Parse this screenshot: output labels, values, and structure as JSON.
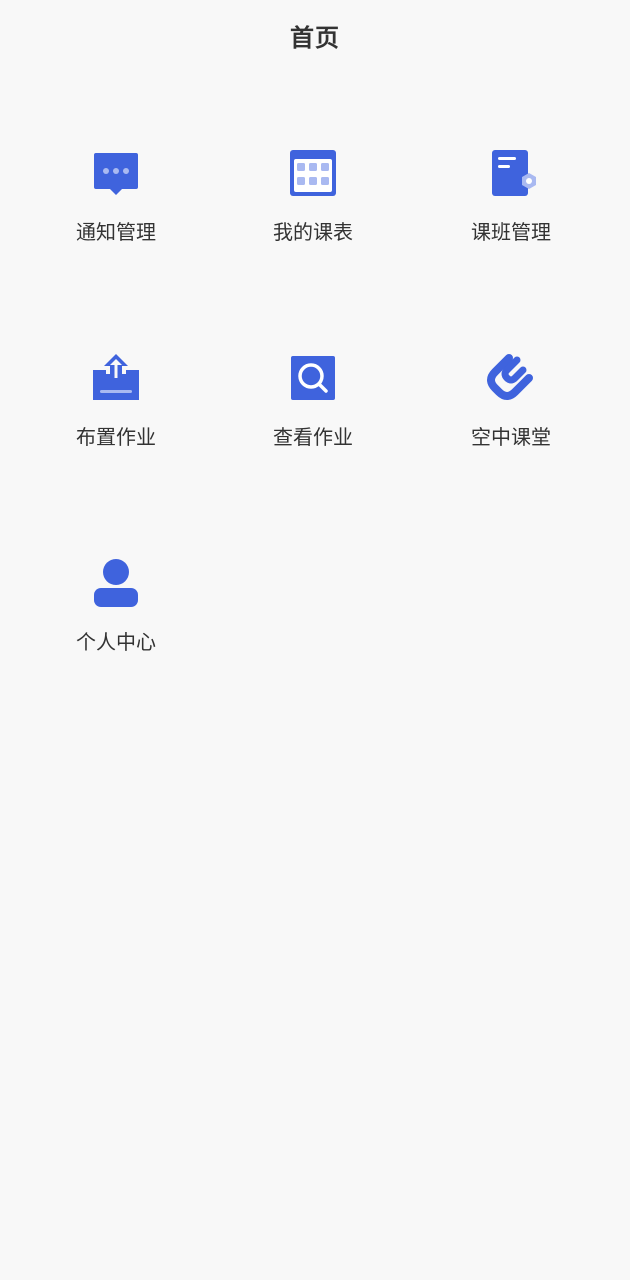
{
  "header": {
    "title": "首页"
  },
  "theme": {
    "accent": "#3f63dd",
    "accent_light": "#a9b9f1"
  },
  "menu": [
    {
      "label": "通知管理",
      "icon": "message-icon"
    },
    {
      "label": "我的课表",
      "icon": "calendar-icon"
    },
    {
      "label": "课班管理",
      "icon": "class-document-icon"
    },
    {
      "label": "布置作业",
      "icon": "upload-icon"
    },
    {
      "label": "查看作业",
      "icon": "search-icon"
    },
    {
      "label": "空中课堂",
      "icon": "paperclip-icon"
    },
    {
      "label": "个人中心",
      "icon": "user-icon"
    }
  ]
}
